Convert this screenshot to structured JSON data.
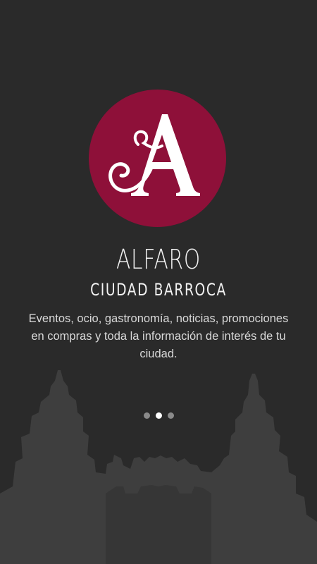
{
  "app": {
    "title": "ALFARO",
    "subtitle": "CIUDAD BARROCA",
    "logo_letter": "A",
    "logo_color": "#8e1039",
    "description": "Eventos, ocio, gastronomía, noticias, promociones en compras y toda la información de interés de tu ciudad."
  },
  "pager": {
    "pages": 3,
    "active_index": 1
  },
  "colors": {
    "background": "#2a2a2a",
    "silhouette": "#3d3d3d",
    "dot_inactive": "#8a8a8a",
    "dot_active": "#ffffff"
  }
}
